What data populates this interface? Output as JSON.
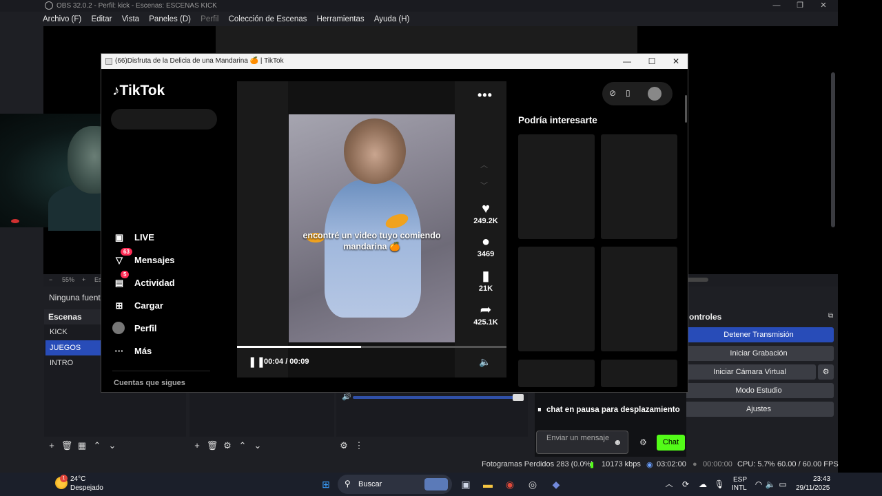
{
  "obs": {
    "title": "OBS 32.0.2 - Perfil: kick - Escenas: ESCENAS KICK",
    "menu": [
      "Archivo (F)",
      "Editar",
      "Vista",
      "Paneles (D)",
      "Perfil",
      "Colección de Escenas",
      "Herramientas",
      "Ayuda (H)"
    ],
    "zoom": "55%",
    "zoom_minus": "−",
    "zoom_plus": "+",
    "zoom_suffix": "Es",
    "source_status": "Ninguna fuente s",
    "scenes_header": "Escenas",
    "scenes": [
      "KICK",
      "JUEGOS",
      "INTRO"
    ],
    "controls_header": "ontroles",
    "controls": [
      "Detener Transmisión",
      "Iniciar Grabación",
      "Iniciar Cámara Virtual",
      "Modo Estudio",
      "Ajustes"
    ],
    "chat_paused": "chat en pausa para desplazamiento",
    "chat_placeholder": "Enviar un mensaje",
    "chat_button": "Chat",
    "status": {
      "dropped_frames": "Fotogramas Perdidos 283 (0.0%)",
      "bitrate": "10173 kbps",
      "stream_time": "03:02:00",
      "rec_time": "00:00:00",
      "cpu": "CPU: 5.7%",
      "fps": "60.00 / 60.00 FPS"
    }
  },
  "browser": {
    "title": "(66)Disfruta de la Delicia de una Mandarina 🍊 | TikTok",
    "min": "—",
    "max": "☐",
    "close": "✕"
  },
  "tiktok": {
    "logo": "TikTok",
    "nav": [
      {
        "label": "LIVE",
        "icon": "live-icon"
      },
      {
        "label": "Mensajes",
        "icon": "messages-icon",
        "badge": "63"
      },
      {
        "label": "Actividad",
        "icon": "activity-icon",
        "badge": "5"
      },
      {
        "label": "Cargar",
        "icon": "upload-icon"
      },
      {
        "label": "Perfil",
        "icon": "profile-icon"
      },
      {
        "label": "Más",
        "icon": "more-icon"
      }
    ],
    "following": "Cuentas que sigues",
    "video_caption": "encontré un video tuyo comiendo mandarina 🍊",
    "likes": "249.2K",
    "comments": "3469",
    "saves": "21K",
    "shares": "425.1K",
    "time": "00:04 / 00:09",
    "progress": 0.46,
    "suggest_title": "Podría interesarte"
  },
  "taskbar": {
    "temp": "24°C",
    "weather": "Despejado",
    "weather_badge": "1",
    "search": "Buscar",
    "lang1": "ESP",
    "lang2": "INTL",
    "clock": "23:43",
    "date": "29/11/2025"
  },
  "colors": {
    "obs_accent": "#284cb8",
    "kick_green": "#53fc18",
    "tiktok_red": "#fe2c55"
  }
}
